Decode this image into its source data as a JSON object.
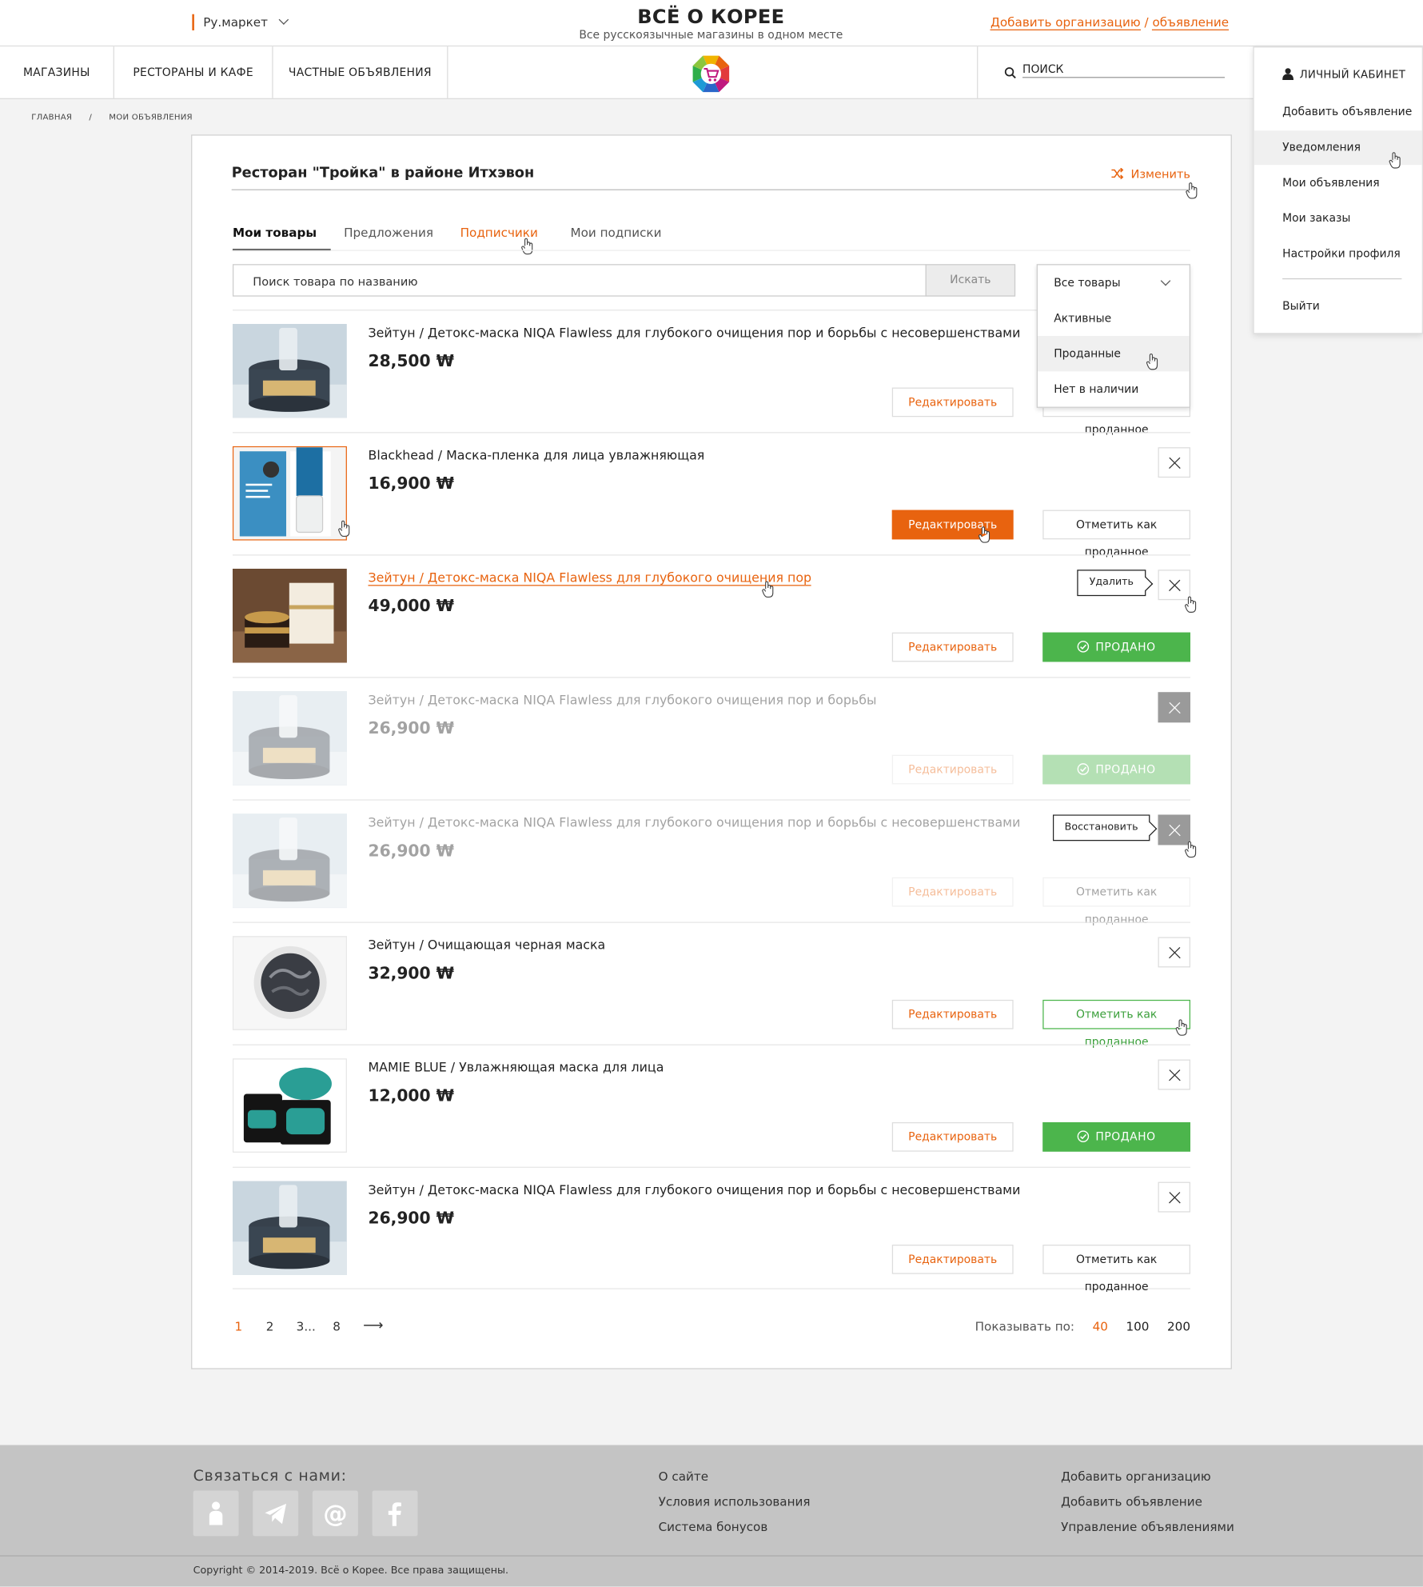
{
  "header": {
    "region": "Ру.маркет",
    "site_title": "ВСЁ О КОРЕЕ",
    "site_subtitle": "Все русскоязычные магазины в одном месте",
    "add_org": "Добавить организацию",
    "add_sep": "/",
    "add_ad": "объявление"
  },
  "nav": {
    "stores": "МАГАЗИНЫ",
    "restaurants": "РЕСТОРАНЫ И КАФЕ",
    "private_ads": "ЧАСТНЫЕ ОБЪЯВЛЕНИЯ",
    "search_label": "ПОИСК",
    "account": "ЛИЧНЫЙ КАБИНЕТ"
  },
  "account_menu": {
    "items": [
      "Добавить объявление",
      "Уведомления",
      "Мои объявления",
      "Мои заказы",
      "Настройки профиля"
    ],
    "logout": "Выйти"
  },
  "breadcrumb": {
    "home": "ГЛАВНАЯ",
    "sep": "/",
    "current": "МОИ ОБЪЯВЛЕНИЯ"
  },
  "panel": {
    "title": "Ресторан \"Тройка\" в районе Итхэвон",
    "change": "Изменить",
    "tabs": [
      "Мои товары",
      "Предложения",
      "Подписчики",
      "Мои подписки"
    ],
    "search_placeholder": "Поиск товара по названию",
    "search_button": "Искать",
    "filter": {
      "selected": "Все товары",
      "options": [
        "Активные",
        "Проданные",
        "Нет в наличии"
      ]
    }
  },
  "labels": {
    "edit": "Редактировать",
    "mark_sold": "Отметить как проданное",
    "sold": "ПРОДАНО",
    "delete_tip": "Удалить",
    "restore_tip": "Восстановить"
  },
  "products": [
    {
      "title": "Зейтун / Детокс-маска NIQA Flawless для глубокого очищения пор и борьбы с несовершенствами",
      "price": "28,500 ₩"
    },
    {
      "title": "Blackhead / Маска-пленка для лица увлажняющая",
      "price": "16,900 ₩"
    },
    {
      "title": "Зейтун / Детокс-маска NIQA Flawless для глубокого очищения пор",
      "price": "49,000 ₩"
    },
    {
      "title": "Зейтун / Детокс-маска NIQA Flawless для глубокого очищения пор и борьбы",
      "price": "26,900 ₩"
    },
    {
      "title": "Зейтун / Детокс-маска NIQA Flawless для глубокого очищения пор и борьбы с несовершенствами",
      "price": "26,900 ₩"
    },
    {
      "title": "Зейтун / Очищающая черная маска",
      "price": "32,900 ₩"
    },
    {
      "title": "MAMIE BLUE / Увлажняющая маска для лица",
      "price": "12,000 ₩"
    },
    {
      "title": "Зейтун / Детокс-маска NIQA Flawless для глубокого очищения пор и борьбы с несовершенствами",
      "price": "26,900 ₩"
    }
  ],
  "pagination": {
    "pages": [
      "1",
      "2",
      "3...",
      "8"
    ],
    "next": "⟶",
    "per_page_label": "Показывать по:",
    "per_page": [
      "40",
      "100",
      "200"
    ]
  },
  "footer": {
    "contact": "Связаться с нами:",
    "col1": [
      "О сайте",
      "Условия использования",
      "Система бонусов"
    ],
    "col2": [
      "Добавить организацию",
      "Добавить объявление",
      "Управление объявлениями"
    ],
    "copyright": "Copyright © 2014-2019. Всё о Корее. Все права защищены."
  },
  "colors": {
    "accent": "#e8630f",
    "success": "#4cb54c",
    "footer_bg": "#c4c4c4"
  }
}
